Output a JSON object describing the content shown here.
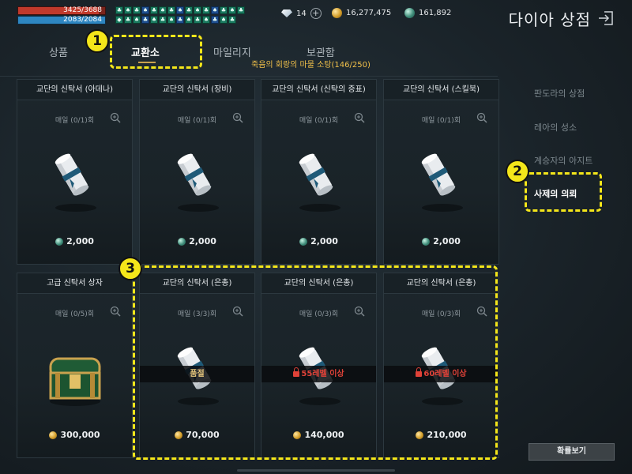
{
  "hud": {
    "hp": {
      "text": "3425/3688",
      "current": 3425,
      "max": 3688
    },
    "mp": {
      "text": "2083/2084",
      "current": 2083,
      "max": 2084
    },
    "buffs_row1": [
      "♣",
      "♠",
      "♣",
      "♠",
      "♣",
      "♠",
      "♣",
      "♠",
      "♣",
      "♠",
      "♣",
      "♠",
      "♣",
      "♠",
      "♣"
    ],
    "buffs_row2": [
      "◆",
      "♣",
      "♠",
      "♣",
      "♠",
      "♣",
      "♠",
      "♣",
      "♠",
      "♣",
      "♠",
      "♣",
      "♠",
      "♣"
    ]
  },
  "currency": {
    "diamond": "14",
    "gold": "16,277,475",
    "coin": "161,892"
  },
  "header": {
    "title": "다이아 상점",
    "exit_icon": "exit-icon"
  },
  "tabs": [
    {
      "label": "상품"
    },
    {
      "label": "교환소",
      "active": true
    },
    {
      "label": "마일리지"
    },
    {
      "label": "보관함"
    }
  ],
  "tab_subtitle": "죽음의 회랑의 마물 소탕(146/250)",
  "cards": [
    {
      "title": "교단의 신탁서 (아데나)",
      "limit": "매일 (0/1)회",
      "price": "2,000",
      "currency": "coin",
      "item": "scroll"
    },
    {
      "title": "교단의 신탁서 (장비)",
      "limit": "매일 (0/1)회",
      "price": "2,000",
      "currency": "coin",
      "item": "scroll"
    },
    {
      "title": "교단의 신탁서 (신탁의 증표)",
      "limit": "매일 (0/1)회",
      "price": "2,000",
      "currency": "coin",
      "item": "scroll"
    },
    {
      "title": "교단의 신탁서 (스킬북)",
      "limit": "매일 (0/1)회",
      "price": "2,000",
      "currency": "coin",
      "item": "scroll"
    },
    {
      "title": "고급 신탁서 상자",
      "limit": "매일 (0/5)회",
      "price": "300,000",
      "currency": "gold",
      "item": "chest"
    },
    {
      "title": "교단의 신탁서 (은총)",
      "limit": "매일 (3/3)회",
      "price": "70,000",
      "currency": "gold",
      "item": "scroll",
      "banner": "품절",
      "banner_type": "soldout"
    },
    {
      "title": "교단의 신탁서 (은총)",
      "limit": "매일 (0/3)회",
      "price": "140,000",
      "currency": "gold",
      "item": "scroll",
      "banner": "55레벨 이상",
      "banner_type": "locked"
    },
    {
      "title": "교단의 신탁서 (은총)",
      "limit": "매일 (0/3)회",
      "price": "210,000",
      "currency": "gold",
      "item": "scroll",
      "banner": "60레벨 이상",
      "banner_type": "locked"
    }
  ],
  "side_menu": [
    {
      "label": "판도라의 상점"
    },
    {
      "label": "레아의 성소"
    },
    {
      "label": "계승자의 아지트"
    },
    {
      "label": "사제의 의뢰",
      "active": true
    }
  ],
  "odds_button": "확률보기",
  "annotations": [
    "1",
    "2",
    "3"
  ],
  "colors": {
    "accent": "#f4e61a",
    "locked": "#e04238",
    "gold": "#d39e2a",
    "coin": "#3f8d7a"
  }
}
